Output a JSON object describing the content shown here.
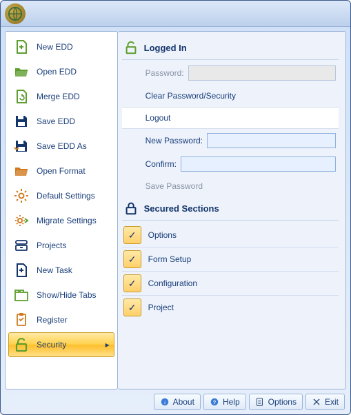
{
  "menu": {
    "items": [
      {
        "id": "new-edd",
        "label": "New EDD",
        "icon": "file-plus",
        "color": "#5e9e2e"
      },
      {
        "id": "open-edd",
        "label": "Open EDD",
        "icon": "folder-open",
        "color": "#5e9e2e"
      },
      {
        "id": "merge-edd",
        "label": "Merge EDD",
        "icon": "file-refresh",
        "color": "#5e9e2e"
      },
      {
        "id": "save-edd",
        "label": "Save EDD",
        "icon": "floppy",
        "color": "#14356a"
      },
      {
        "id": "save-edd-as",
        "label": "Save EDD As",
        "icon": "floppy-as",
        "color": "#14356a"
      },
      {
        "id": "open-format",
        "label": "Open Format",
        "icon": "folder-open",
        "color": "#d17a1f"
      },
      {
        "id": "default-settings",
        "label": "Default Settings",
        "icon": "gear",
        "color": "#d17a1f"
      },
      {
        "id": "migrate-settings",
        "label": "Migrate Settings",
        "icon": "gear-arrow",
        "color": "#d17a1f"
      },
      {
        "id": "projects",
        "label": "Projects",
        "icon": "drawer",
        "color": "#14356a"
      },
      {
        "id": "new-task",
        "label": "New Task",
        "icon": "file-plus",
        "color": "#14356a"
      },
      {
        "id": "show-hide-tabs",
        "label": "Show/Hide Tabs",
        "icon": "tabs",
        "color": "#5e9e2e"
      },
      {
        "id": "register",
        "label": "Register",
        "icon": "clipboard",
        "color": "#d17a1f"
      },
      {
        "id": "security",
        "label": "Security",
        "icon": "padlock-open",
        "color": "#5e9e2e",
        "active": true,
        "submenu": true
      }
    ]
  },
  "security_panel": {
    "logged_in_title": "Logged In",
    "password_label": "Password:",
    "password_value": "",
    "clear_label": "Clear Password/Security",
    "logout_label": "Logout",
    "new_password_label": "New Password:",
    "new_password_value": "",
    "confirm_label": "Confirm:",
    "confirm_value": "",
    "save_password_label": "Save Password",
    "secured_sections_title": "Secured Sections",
    "sections": [
      {
        "label": "Options",
        "checked": true
      },
      {
        "label": "Form Setup",
        "checked": true
      },
      {
        "label": "Configuration",
        "checked": true
      },
      {
        "label": "Project",
        "checked": true
      }
    ]
  },
  "footer": {
    "about": "About",
    "help": "Help",
    "options": "Options",
    "exit": "Exit"
  }
}
